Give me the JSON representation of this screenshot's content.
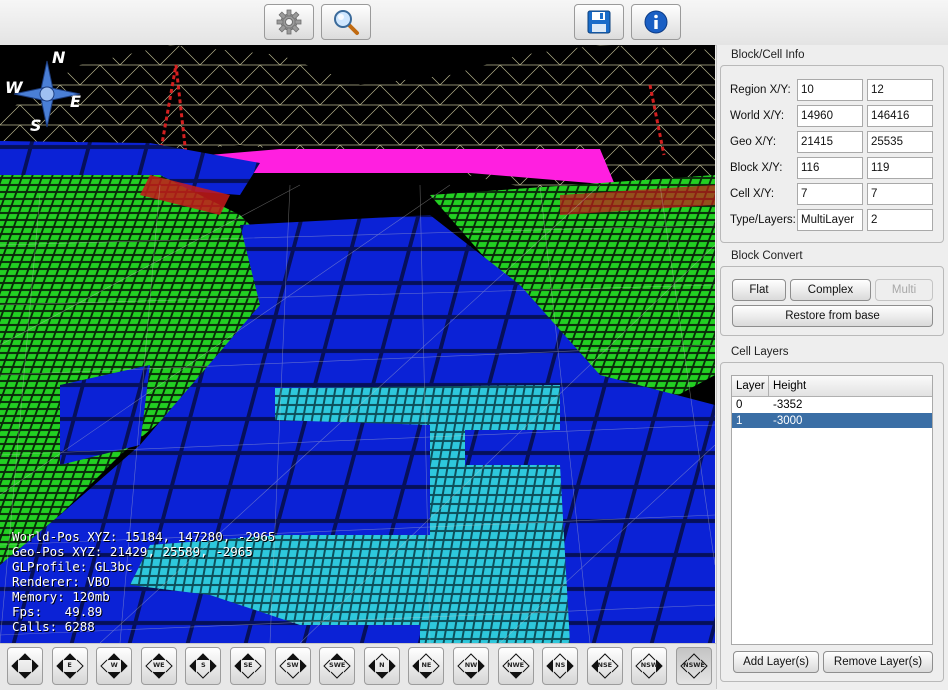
{
  "toolbar": {
    "buttons": [
      {
        "icon": "gear-icon"
      },
      {
        "icon": "search-icon"
      },
      {
        "icon": "save-icon"
      },
      {
        "icon": "info-icon"
      }
    ]
  },
  "compass": {
    "n": "N",
    "s": "S",
    "e": "E",
    "w": "W"
  },
  "overlay": {
    "world_pos": "World-Pos XYZ: 15184, 147280, -2965",
    "geo_pos": "Geo-Pos XYZ: 21429, 25589, -2965",
    "gl_profile": "GLProfile: GL3bc",
    "renderer": "Renderer: VBO",
    "memory": "Memory: 120mb",
    "fps": "Fps:   49.89",
    "calls": "Calls: 6288"
  },
  "block_cell_info": {
    "title": "Block/Cell Info",
    "rows": [
      {
        "label": "Region X/Y:",
        "v1": "10",
        "v2": "12"
      },
      {
        "label": "World X/Y:",
        "v1": "14960",
        "v2": "146416"
      },
      {
        "label": "Geo X/Y:",
        "v1": "21415",
        "v2": "25535"
      },
      {
        "label": "Block X/Y:",
        "v1": "116",
        "v2": "119"
      },
      {
        "label": "Cell X/Y:",
        "v1": "7",
        "v2": "7"
      },
      {
        "label": "Type/Layers:",
        "v1": "MultiLayer",
        "v2": "2"
      }
    ]
  },
  "block_convert": {
    "title": "Block Convert",
    "flat": "Flat",
    "complex": "Complex",
    "multi": "Multi",
    "restore": "Restore from base"
  },
  "cell_layers": {
    "title": "Cell Layers",
    "columns": [
      "Layer",
      "Height"
    ],
    "rows": [
      {
        "layer": "0",
        "height": "-3352"
      },
      {
        "layer": "1",
        "height": "-3000"
      }
    ],
    "selected_row": 1,
    "add": "Add Layer(s)",
    "remove": "Remove Layer(s)"
  },
  "nav_buttons": [
    "",
    "E",
    "W",
    "WE",
    "S",
    "SE",
    "SW",
    "SWE",
    "N",
    "NE",
    "NW",
    "NWE",
    "NS",
    "NSE",
    "NSW",
    "NSWE"
  ],
  "nav_active": "NSWE",
  "colors": {
    "terrain_blue": "#0a1ed8",
    "terrain_green": "#1fc81f",
    "terrain_cyan": "#27c7d9",
    "highlight_magenta": "#ff1fe0",
    "selection": "#3a6ea5"
  }
}
